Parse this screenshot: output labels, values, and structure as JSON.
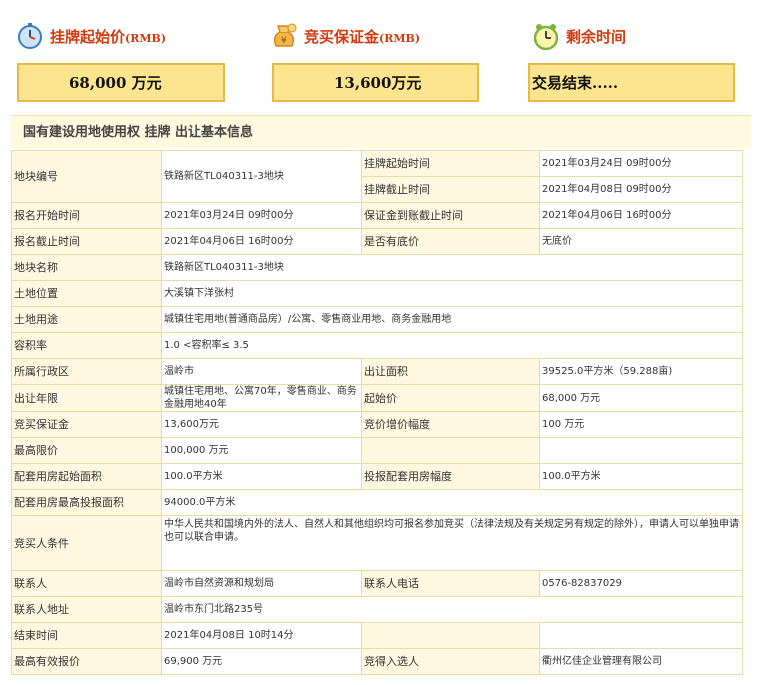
{
  "header": {
    "start_price_title": "挂牌起始价",
    "start_price_unit": "(RMB)",
    "deposit_title": "竞买保证金",
    "deposit_unit": "(RMB)",
    "remaining_title": "剩余时间",
    "start_price_value": "68,000 万元",
    "deposit_value": "13,600万元",
    "remaining_value": "交易结束.....",
    "icons": [
      "stopwatch-icon",
      "money-bag-icon",
      "clock-icon"
    ]
  },
  "section_title": "国有建设用地使用权 挂牌 出让基本信息",
  "rows": {
    "parcel_no_label": "地块编号",
    "parcel_no": "铁路新区TL040311-3地块",
    "listing_start_label": "挂牌起始时间",
    "listing_start": "2021年03月24日 09时00分",
    "listing_end_label": "挂牌截止时间",
    "listing_end": "2021年04月08日 09时00分",
    "reg_start_label": "报名开始时间",
    "reg_start": "2021年03月24日 09时00分",
    "deposit_deadline_label": "保证金到账截止时间",
    "deposit_deadline": "2021年04月06日 16时00分",
    "reg_end_label": "报名截止时间",
    "reg_end": "2021年04月06日 16时00分",
    "reserve_label": "是否有底价",
    "reserve": "无底价",
    "parcel_name_label": "地块名称",
    "parcel_name": "铁路新区TL040311-3地块",
    "location_label": "土地位置",
    "location": "大溪镇下洋张村",
    "use_label": "土地用途",
    "use": "城镇住宅用地(普通商品房）/公寓、零售商业用地、商务金融用地",
    "far_label": "容积率",
    "far": "1.0 <容积率≤ 3.5",
    "district_label": "所属行政区",
    "district": "温岭市",
    "area_label": "出让面积",
    "area": "39525.0平方米（59.288亩)",
    "term_label": "出让年限",
    "term": "城镇住宅用地、公寓70年，零售商业、商务金融用地40年",
    "start_price_label": "起始价",
    "start_price": "68,000 万元",
    "bid_deposit_label": "竞买保证金",
    "bid_deposit": "13,600万元",
    "increment_label": "竞价增价幅度",
    "increment": "100 万元",
    "max_price_label": "最高限价",
    "max_price": "100,000 万元",
    "housing_start_label": "配套用房起始面积",
    "housing_start": "100.0平方米",
    "housing_increment_label": "投报配套用房幅度",
    "housing_increment": "100.0平方米",
    "housing_max_label": "配套用房最高投报面积",
    "housing_max": "94000.0平方米",
    "conditions_label": "竞买人条件",
    "conditions": "中华人民共和国境内外的法人、自然人和其他组织均可报名参加竞买（法律法规及有关规定另有规定的除外），申请人可以单独申请也可以联合申请。",
    "contact_label": "联系人",
    "contact": "温岭市自然资源和规划局",
    "phone_label": "联系人电话",
    "phone": "0576-82837029",
    "address_label": "联系人地址",
    "address": "温岭市东门北路235号",
    "end_time_label": "结束时间",
    "end_time": "2021年04月08日 10时14分",
    "top_bid_label": "最高有效报价",
    "top_bid": "69,900 万元",
    "winner_label": "竞得入选人",
    "winner": "衢州亿佳企业管理有限公司"
  }
}
